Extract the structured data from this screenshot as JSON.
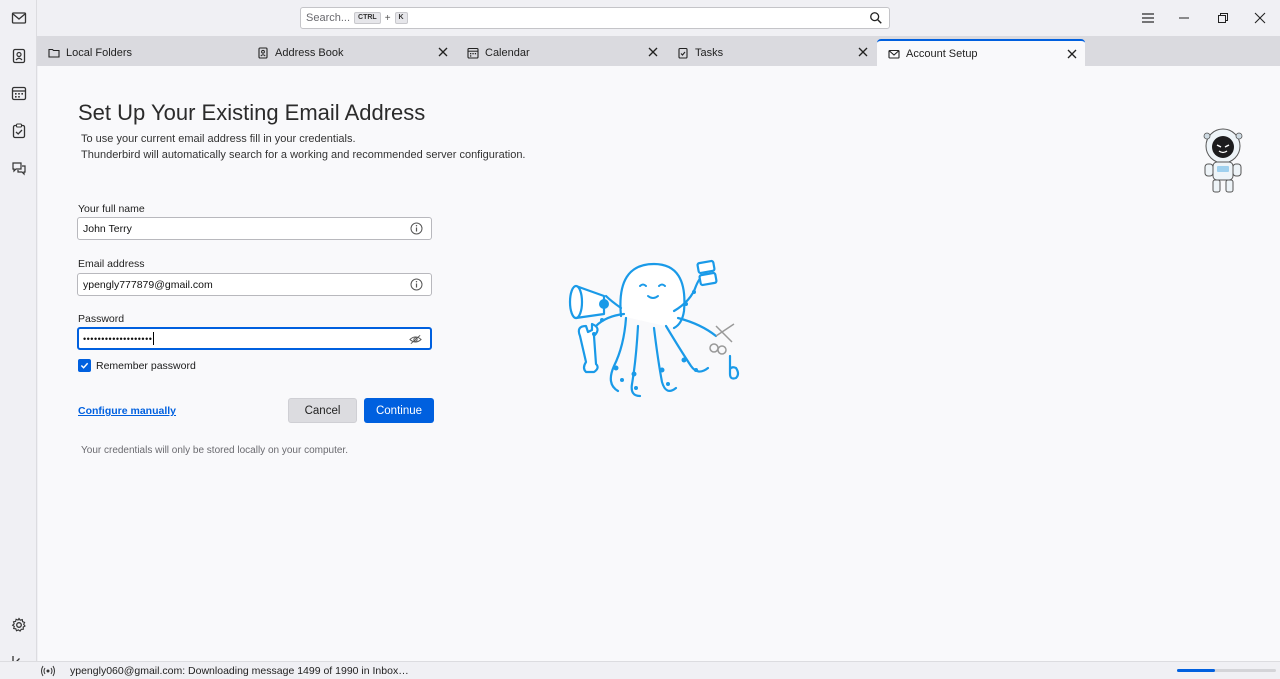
{
  "search": {
    "placeholder": "Search...",
    "shortcut_mod": "CTRL",
    "shortcut_plus": "+",
    "shortcut_key": "K"
  },
  "spaces": {
    "items": [
      {
        "name": "mail",
        "icon": "mail-icon"
      },
      {
        "name": "address-book",
        "icon": "address-book-icon"
      },
      {
        "name": "calendar",
        "icon": "calendar-icon"
      },
      {
        "name": "tasks",
        "icon": "tasks-icon"
      },
      {
        "name": "chat",
        "icon": "chat-icon"
      }
    ],
    "bottom": [
      {
        "name": "settings",
        "icon": "gear-icon"
      },
      {
        "name": "collapse",
        "icon": "collapse-left-icon"
      }
    ]
  },
  "tabs": [
    {
      "label": "Local Folders",
      "icon": "folder-icon",
      "closable": false
    },
    {
      "label": "Address Book",
      "icon": "address-book-icon",
      "closable": true
    },
    {
      "label": "Calendar",
      "icon": "calendar-icon",
      "closable": true
    },
    {
      "label": "Tasks",
      "icon": "tasks-icon",
      "closable": true
    },
    {
      "label": "Account Setup",
      "icon": "mail-icon",
      "closable": true,
      "active": true
    }
  ],
  "setup": {
    "title": "Set Up Your Existing Email Address",
    "subtitle_line1": "To use your current email address fill in your credentials.",
    "subtitle_line2": "Thunderbird will automatically search for a working and recommended server configuration.",
    "name_label": "Your full name",
    "name_value": "John Terry",
    "email_label": "Email address",
    "email_value": "ypengly777879@gmail.com",
    "password_label": "Password",
    "password_mask": "•••••••••••••••••••",
    "remember_label": "Remember password",
    "remember_checked": true,
    "configure_label": "Configure manually",
    "cancel_label": "Cancel",
    "continue_label": "Continue",
    "note": "Your credentials will only be stored locally on your computer."
  },
  "status": {
    "text": "ypengly060@gmail.com: Downloading message 1499 of 1990 in Inbox…",
    "progress_fraction": 0.38
  },
  "colors": {
    "accent": "#0060df",
    "illustration": "#1a9ae8"
  }
}
